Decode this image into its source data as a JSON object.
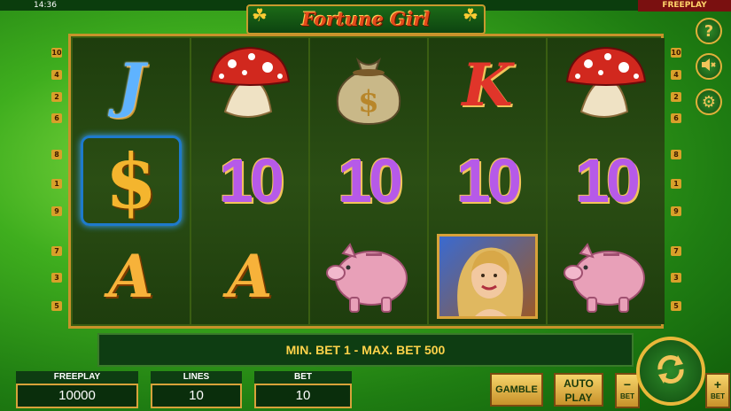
{
  "status": {
    "time": "14:36",
    "mode_tag": "FREEPLAY"
  },
  "title": "Fortune Girl",
  "reels": [
    [
      "J",
      "$",
      "A"
    ],
    [
      "mushroom",
      "10",
      "A"
    ],
    [
      "money-bag",
      "10",
      "piggy-bank"
    ],
    [
      "K",
      "10",
      "fortune-girl"
    ],
    [
      "mushroom",
      "10",
      "piggy-bank"
    ]
  ],
  "line_markers_left": [
    "10",
    "4",
    "2",
    "6",
    "8",
    "1",
    "9",
    "7",
    "3",
    "5"
  ],
  "line_markers_right": [
    "10",
    "4",
    "2",
    "6",
    "8",
    "1",
    "9",
    "7",
    "3",
    "5"
  ],
  "side_buttons": {
    "help": "?",
    "sound_icon": "speaker-muted-icon",
    "settings_icon": "gear-icon"
  },
  "message": "MIN. BET 1 - MAX. BET 500",
  "freeplay": {
    "label": "FREEPLAY",
    "value": "10000"
  },
  "lines": {
    "label": "LINES",
    "value": "10"
  },
  "bet": {
    "label": "BET",
    "value": "10"
  },
  "buttons": {
    "gamble": "GAMBLE",
    "auto_play_1": "AUTO",
    "auto_play_2": "PLAY",
    "bet_minus": "−",
    "bet_minus_label": "BET",
    "bet_plus": "+",
    "bet_plus_label": "BET"
  },
  "colors": {
    "accent_gold": "#d8a23a",
    "felt_green": "#1e3d0d",
    "message_text": "#ffd34a"
  }
}
